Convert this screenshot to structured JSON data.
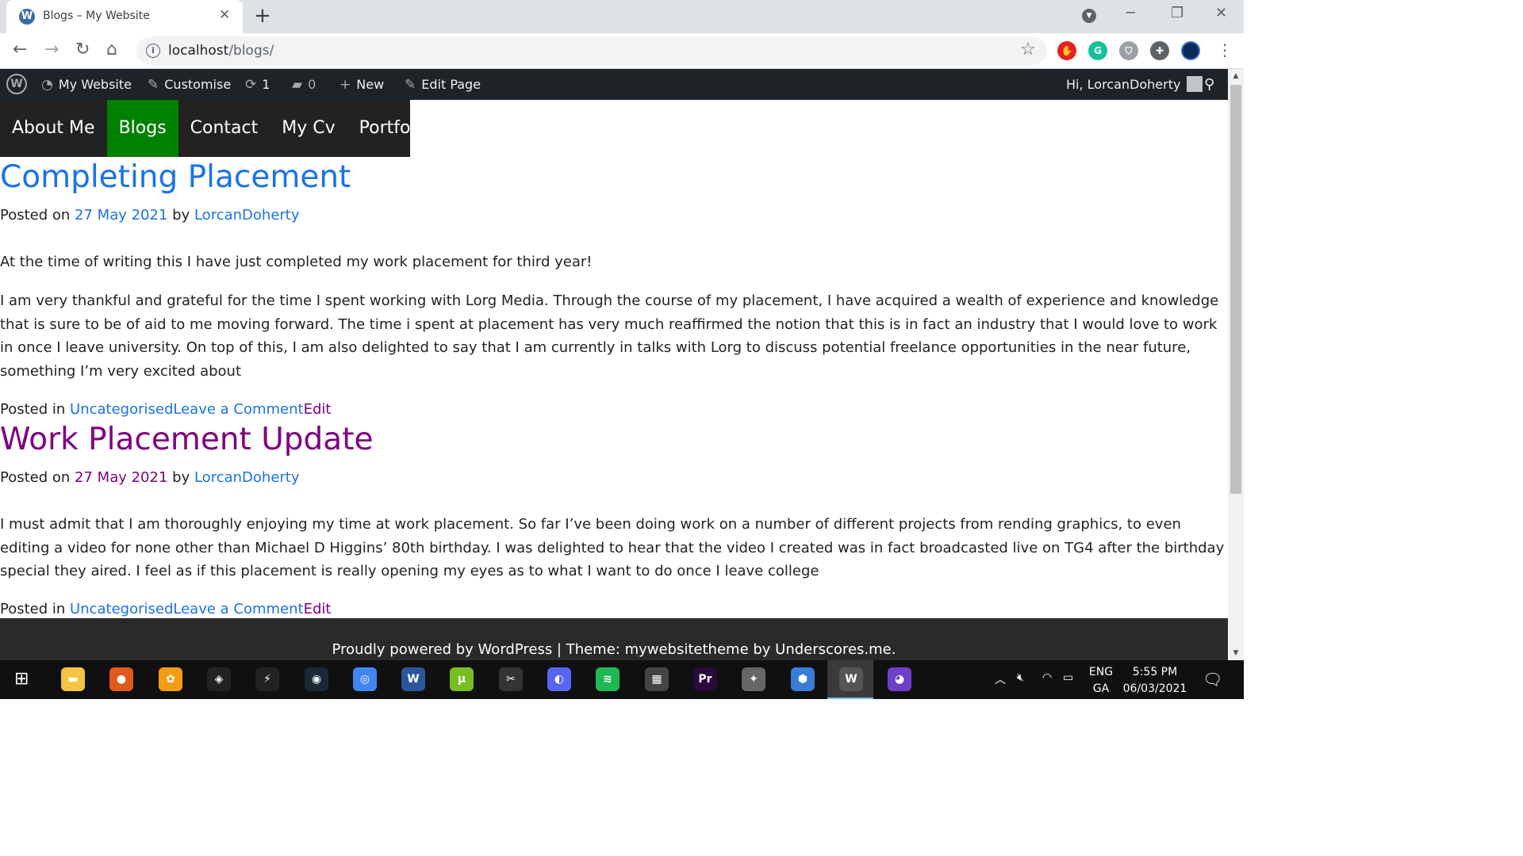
{
  "browser": {
    "tab_title": "Blogs – My Website",
    "tab_favicon": "W",
    "url_host": "localhost",
    "url_path": "/blogs/",
    "extensions": [
      {
        "name": "adblock-extension-icon",
        "label": "✋",
        "color": "#e8201f"
      },
      {
        "name": "grammarly-extension-icon",
        "label": "G",
        "color": "#15c39a"
      },
      {
        "name": "shield-extension-icon",
        "label": "⛉",
        "color": "#9aa0a6"
      },
      {
        "name": "extensions-puzzle-icon",
        "label": "✚",
        "color": "#5f6368"
      }
    ]
  },
  "adminbar": {
    "site_name": "My Website",
    "customise": "Customise",
    "updates_count": "1",
    "comments_count": "0",
    "new_label": "New",
    "edit_page": "Edit Page",
    "greeting": "Hi, LorcanDoherty"
  },
  "nav": {
    "items": [
      "About Me",
      "Blogs",
      "Contact",
      "My Cv",
      "Portfolio"
    ],
    "active": "Blogs",
    "active_color": "#008000"
  },
  "posts": [
    {
      "title": "Completing Placement",
      "posted_on": "Posted on",
      "date": "27 May 2021",
      "by": "by",
      "author": "LorcanDoherty",
      "paragraphs": [
        "At the time of writing this I have just completed my work placement for third year!",
        "I am very thankful and grateful for the time I spent working with Lorg Media. Through the course of my placement, I have acquired a wealth of experience and knowledge that is sure to be of aid to me moving forward. The time i spent at placement has very much reaffirmed the notion that this is in fact an industry that I would love to work in once I leave university. On top of this, I am also delighted to say that I am currently in talks with Lorg to discuss potential freelance opportunities in the near future, something I’m very excited about"
      ],
      "posted_in": "Posted in",
      "category": "Uncategorised",
      "comment_link": "Leave a Comment",
      "edit_link": "Edit"
    },
    {
      "title": "Work Placement Update",
      "posted_on": "Posted on",
      "date": "27 May 2021",
      "by": "by",
      "author": "LorcanDoherty",
      "paragraphs": [
        "I must admit that I am thoroughly enjoying my time at work placement. So far I’ve been doing work on a number of different projects from rending graphics, to even editing a video for none other than Michael D Higgins’ 80th birthday. I was delighted to hear that the video I created was in fact broadcasted live on TG4 after the birthday special they aired. I feel as if this placement is really opening my eyes as to what I want to do once I leave college"
      ],
      "posted_in": "Posted in",
      "category": "Uncategorised",
      "comment_link": "Leave a Comment",
      "edit_link": "Edit"
    }
  ],
  "footer": {
    "text": "Proudly powered by WordPress | Theme: mywebsitetheme by Underscores.me."
  },
  "taskbar": {
    "apps": [
      {
        "name": "file-explorer-taskbar-icon",
        "label": "▬",
        "color": "#f4c542"
      },
      {
        "name": "app-taskbar-icon-1",
        "label": "●",
        "color": "#e05a1c"
      },
      {
        "name": "fl-studio-taskbar-icon",
        "label": "✿",
        "color": "#f39c12"
      },
      {
        "name": "unity-taskbar-icon",
        "label": "◈",
        "color": "#222222"
      },
      {
        "name": "app-taskbar-icon-2",
        "label": "⚡",
        "color": "#222222"
      },
      {
        "name": "steam-taskbar-icon",
        "label": "◉",
        "color": "#1b2838"
      },
      {
        "name": "chrome-taskbar-icon",
        "label": "◎",
        "color": "#4285f4"
      },
      {
        "name": "word-taskbar-icon",
        "label": "W",
        "color": "#2b579a"
      },
      {
        "name": "utorrent-taskbar-icon",
        "label": "µ",
        "color": "#78be20"
      },
      {
        "name": "app-taskbar-icon-3",
        "label": "✂",
        "color": "#333333"
      },
      {
        "name": "discord-taskbar-icon",
        "label": "◐",
        "color": "#5865f2"
      },
      {
        "name": "spotify-taskbar-icon",
        "label": "≋",
        "color": "#1db954"
      },
      {
        "name": "calculator-taskbar-icon",
        "label": "▦",
        "color": "#444444"
      },
      {
        "name": "premiere-taskbar-icon",
        "label": "Pr",
        "color": "#2a0a3a"
      },
      {
        "name": "app-taskbar-icon-4",
        "label": "✦",
        "color": "#666666"
      },
      {
        "name": "app-taskbar-icon-5",
        "label": "⬢",
        "color": "#3a7bd5"
      },
      {
        "name": "wordpress-app-taskbar-icon",
        "label": "W",
        "color": "#555555"
      },
      {
        "name": "github-taskbar-icon",
        "label": "◕",
        "color": "#6e40c9"
      }
    ],
    "language": "ENG",
    "language_sub": "GA",
    "time": "5:55 PM",
    "date": "06/03/2021"
  }
}
